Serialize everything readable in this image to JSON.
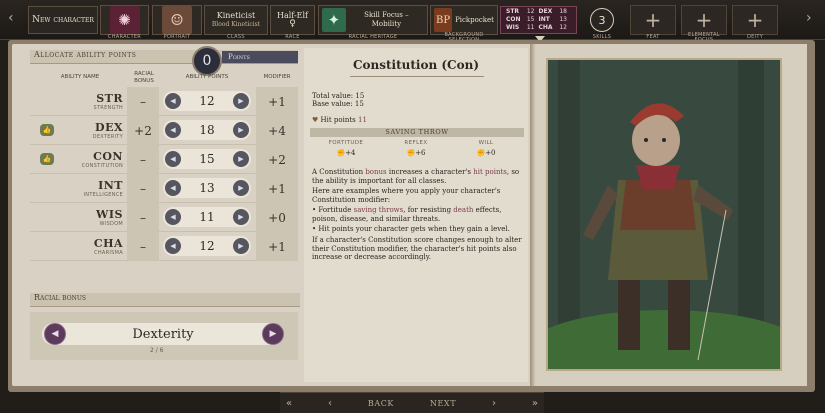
{
  "nav": {
    "new_character": "New character",
    "steps": [
      {
        "label": "CHARACTER",
        "icon": "character-sigil-icon"
      },
      {
        "label": "PORTRAIT",
        "icon": "portrait-thumbnail"
      },
      {
        "title": "Kineticist",
        "subtitle": "Blood Kineticist",
        "label": "CLASS"
      },
      {
        "title": "Half-Elf",
        "label": "RACE",
        "icon": "gender-female-icon"
      },
      {
        "title": "Skill Focus – Mobility",
        "label": "RACIAL HERITAGE",
        "icon": "mobility-figure-icon"
      },
      {
        "title": "Pickpocket",
        "label": "BACKGROUND SELECTION",
        "icon": "background-icon"
      }
    ],
    "stats": [
      {
        "k": "STR",
        "v": "12"
      },
      {
        "k": "DEX",
        "v": "18"
      },
      {
        "k": "CON",
        "v": "15"
      },
      {
        "k": "INT",
        "v": "13"
      },
      {
        "k": "WIS",
        "v": "11"
      },
      {
        "k": "CHA",
        "v": "12"
      }
    ],
    "skills": {
      "value": "3",
      "label": "SKILLS"
    },
    "feat": {
      "label": "FEAT"
    },
    "elemental_focus": {
      "label": "ELEMENTAL FOCUS"
    },
    "deity": {
      "label": "DEITY"
    }
  },
  "allocate": {
    "title": "Allocate ability points",
    "points_value": "0",
    "points_label": "Points",
    "headers": {
      "ability_name": "ABILITY NAME",
      "racial_bonus": "RACIAL BONUS",
      "ability_points": "ABILITY POINTS",
      "modifier": "MODIFIER"
    },
    "rows": [
      {
        "abbr": "STR",
        "full": "STRENGTH",
        "bonus": "–",
        "value": "12",
        "mod": "+1",
        "badge": false
      },
      {
        "abbr": "DEX",
        "full": "DEXTERITY",
        "bonus": "+2",
        "value": "18",
        "mod": "+4",
        "badge": true
      },
      {
        "abbr": "CON",
        "full": "CONSTITUTION",
        "bonus": "–",
        "value": "15",
        "mod": "+2",
        "badge": true
      },
      {
        "abbr": "INT",
        "full": "INTELLIGENCE",
        "bonus": "–",
        "value": "13",
        "mod": "+1",
        "badge": false
      },
      {
        "abbr": "WIS",
        "full": "WISDOM",
        "bonus": "–",
        "value": "11",
        "mod": "+0",
        "badge": false
      },
      {
        "abbr": "CHA",
        "full": "CHARISMA",
        "bonus": "–",
        "value": "12",
        "mod": "+1",
        "badge": false
      }
    ]
  },
  "racial_bonus": {
    "title": "Racial bonus",
    "selected": "Dexterity",
    "count": "2 / 6"
  },
  "description": {
    "title": "Constitution (Con)",
    "total": "Total value: 15",
    "base": "Base value: 15",
    "hit_points_label": "Hit points",
    "hit_points_value": "11",
    "saving_throw": "SAVING THROW",
    "saves": [
      {
        "label": "FORTITUDE",
        "value": "+4"
      },
      {
        "label": "REFLEX",
        "value": "+6"
      },
      {
        "label": "WILL",
        "value": "+0"
      }
    ],
    "p1a": "A Constitution ",
    "p1b": "bonus",
    "p1c": " increases a character's ",
    "p1d": "hit points",
    "p1e": ", so the ability is important for all classes.",
    "p2": "Here are examples where you apply your character's Constitution modifier:",
    "b1a": "• Fortitude ",
    "b1b": "saving throws",
    "b1c": ", for resisting ",
    "b1d": "death",
    "b1e": " effects, poison, disease, and similar threats.",
    "b2": "• Hit points your character gets when they gain a level.",
    "p3": "If a character's Constitution score changes enough to alter their Constitution modifier, the character's hit points also increase or decrease accordingly."
  },
  "footer": {
    "back": "BACK",
    "next": "NEXT"
  }
}
